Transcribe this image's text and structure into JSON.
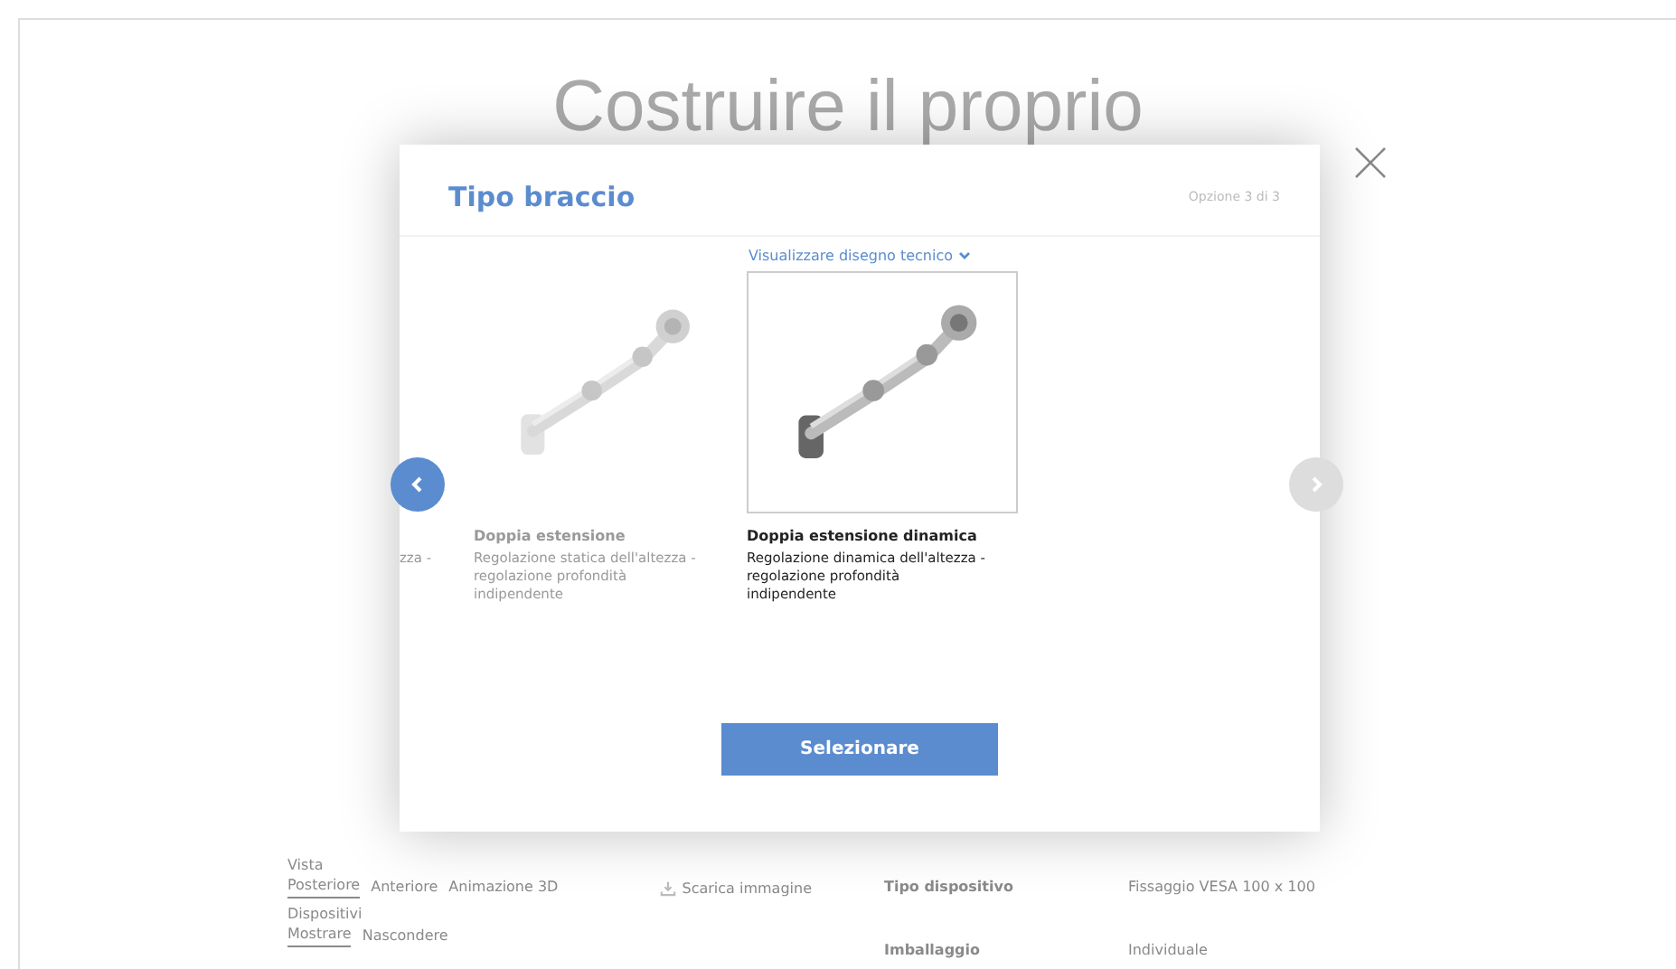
{
  "page": {
    "heading": "Costruire il proprio",
    "view": {
      "label": "Vista",
      "tabs": [
        {
          "label": "Posteriore",
          "selected": true
        },
        {
          "label": "Anteriore",
          "selected": false
        },
        {
          "label": "Animazione 3D",
          "selected": false
        }
      ],
      "download": "Scarica immagine"
    },
    "devices": {
      "label": "Dispositivi",
      "tabs": [
        {
          "label": "Mostrare",
          "selected": true
        },
        {
          "label": "Nascondere",
          "selected": false
        }
      ]
    },
    "specs": [
      {
        "name": "Tipo dispositivo",
        "value": "Fissaggio VESA 100 x 100"
      },
      {
        "name": "Imballaggio",
        "value": "Individuale"
      }
    ]
  },
  "modal": {
    "title": "Tipo braccio",
    "counter": "Opzione 3 di 3",
    "drawing_link": "Visualizzare disegno tecnico",
    "options": [
      {
        "kind": "partial",
        "description": "zza -"
      },
      {
        "kind": "card",
        "title": "Doppia estensione",
        "description": "Regolazione statica dell'altezza - regolazione profondità indipendente",
        "selected": false
      },
      {
        "kind": "card",
        "title": "Doppia estensione dinamica",
        "description": "Regolazione dinamica dell'altezza - regolazione profondità indipendente",
        "selected": true
      }
    ],
    "prev_enabled": true,
    "next_enabled": false,
    "select_button": "Selezionare"
  }
}
